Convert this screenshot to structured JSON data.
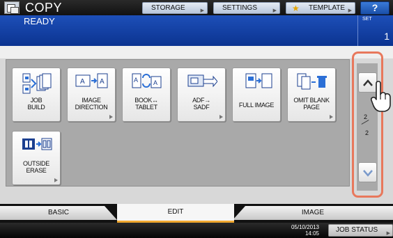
{
  "header": {
    "app_title": "COPY",
    "storage_label": "STORAGE",
    "settings_label": "SETTINGS",
    "template_label": "TEMPLATE",
    "help_label": "?"
  },
  "status": {
    "message": "READY",
    "set_label": "SET",
    "set_count": "1"
  },
  "functions": [
    {
      "line1": "JOB",
      "line2": "BUILD",
      "icon": "job-build-icon"
    },
    {
      "line1": "IMAGE",
      "line2": "DIRECTION",
      "icon": "image-direction-icon"
    },
    {
      "line1": "BOOK↔",
      "line2": "TABLET",
      "icon": "book-tablet-icon"
    },
    {
      "line1": "ADF→",
      "line2": "SADF",
      "icon": "adf-sadf-icon"
    },
    {
      "line1": "FULL IMAGE",
      "line2": "",
      "icon": "full-image-icon"
    },
    {
      "line1": "OMIT BLANK",
      "line2": "PAGE",
      "icon": "omit-blank-page-icon"
    },
    {
      "line1": "OUTSIDE",
      "line2": "ERASE",
      "icon": "outside-erase-icon"
    }
  ],
  "pager": {
    "current": "2",
    "total": "2"
  },
  "tabs": {
    "basic": "BASIC",
    "edit": "EDIT",
    "image": "IMAGE",
    "active": "EDIT"
  },
  "footer": {
    "date": "05/10/2013",
    "time": "14:05",
    "job_status_label": "JOB STATUS"
  },
  "colors": {
    "status_bar": "#1d4fb8",
    "highlight_outline": "#e8785c",
    "active_tab_underline": "#f0a830"
  }
}
